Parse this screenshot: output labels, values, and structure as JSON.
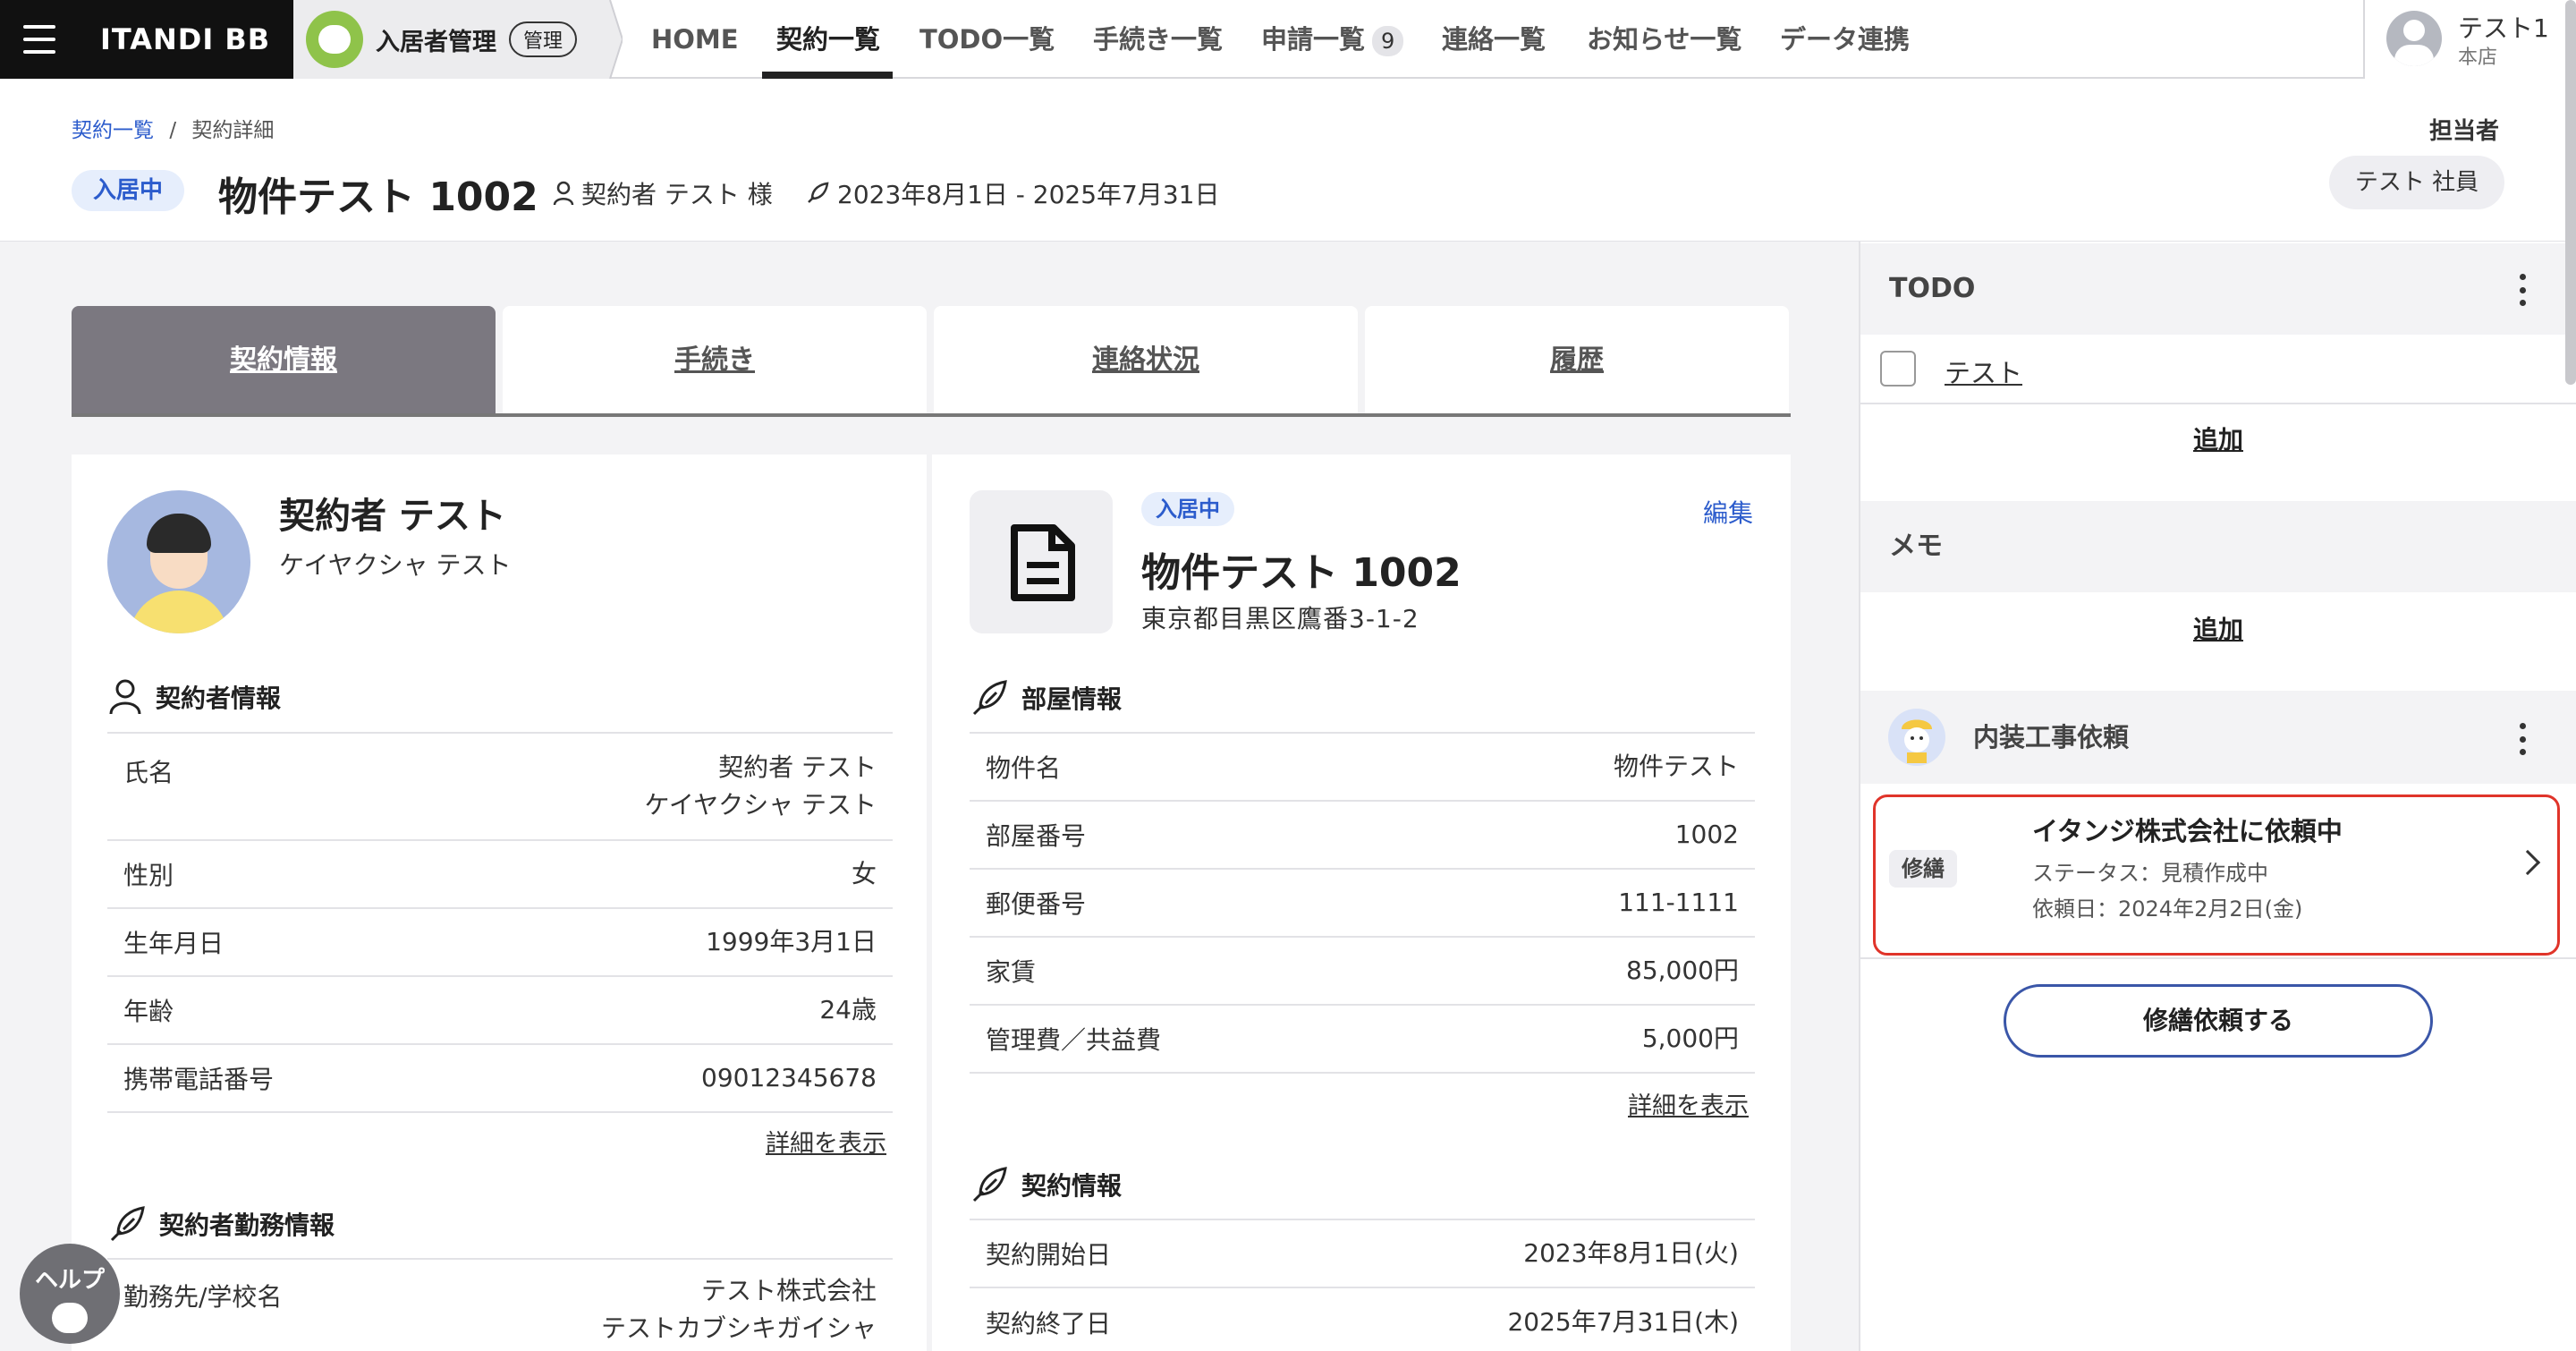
{
  "brand": "ITANDI BB",
  "product": {
    "name": "入居者管理",
    "badge": "管理"
  },
  "nav": [
    {
      "label": "HOME"
    },
    {
      "label": "契約一覧"
    },
    {
      "label": "TODO一覧"
    },
    {
      "label": "手続き一覧"
    },
    {
      "label": "申請一覧",
      "count": "9"
    },
    {
      "label": "連絡一覧"
    },
    {
      "label": "お知らせ一覧"
    },
    {
      "label": "データ連携"
    }
  ],
  "user": {
    "name": "テスト1",
    "branch": "本店"
  },
  "breadcrumb": {
    "parent": "契約一覧",
    "separator": "/",
    "current": "契約詳細"
  },
  "header": {
    "status": "入居中",
    "property_title": "物件テスト 1002",
    "contractor": "契約者 テスト 様",
    "period": "2023年8月1日 - 2025年7月31日",
    "assignee_label": "担当者",
    "assignee": "テスト 社員"
  },
  "tabs": [
    {
      "label": "契約情報"
    },
    {
      "label": "手続き"
    },
    {
      "label": "連絡状況"
    },
    {
      "label": "履歴"
    }
  ],
  "person": {
    "name": "契約者 テスト",
    "kana": "ケイヤクシャ テスト",
    "info_title": "契約者情報",
    "rows": [
      {
        "label": "氏名",
        "value": "契約者 テスト",
        "value2": "ケイヤクシャ テスト"
      },
      {
        "label": "性別",
        "value": "女"
      },
      {
        "label": "生年月日",
        "value": "1999年3月1日"
      },
      {
        "label": "年齢",
        "value": "24歳"
      },
      {
        "label": "携帯電話番号",
        "value": "09012345678"
      }
    ],
    "detail_link": "詳細を表示",
    "work_title": "契約者勤務情報",
    "work_rows": [
      {
        "label": "勤務先/学校名",
        "value": "テスト株式会社",
        "value2": "テストカブシキガイシャ"
      }
    ]
  },
  "property": {
    "status": "入居中",
    "edit": "編集",
    "name": "物件テスト 1002",
    "address": "東京都目黒区鷹番3-1-2",
    "room_title": "部屋情報",
    "rows": [
      {
        "label": "物件名",
        "value": "物件テスト"
      },
      {
        "label": "部屋番号",
        "value": "1002"
      },
      {
        "label": "郵便番号",
        "value": "111-1111"
      },
      {
        "label": "家賃",
        "value": "85,000円"
      },
      {
        "label": "管理費／共益費",
        "value": "5,000円"
      }
    ],
    "detail_link": "詳細を表示",
    "contract_title": "契約情報",
    "contract_rows": [
      {
        "label": "契約開始日",
        "value": "2023年8月1日(火)"
      },
      {
        "label": "契約終了日",
        "value": "2025年7月31日(木)"
      }
    ]
  },
  "side": {
    "todo_title": "TODO",
    "todo_item": "テスト",
    "todo_add": "追加",
    "memo_title": "メモ",
    "memo_add": "追加",
    "repair_title": "内装工事依頼",
    "request": {
      "tag": "修繕",
      "title": "イタンジ株式会社に依頼中",
      "status": "ステータス：見積作成中",
      "date": "依頼日：2024年2月2日(金)"
    },
    "repair_button": "修繕依頼する"
  },
  "help": "ヘルプ",
  "colors": {
    "accent": "#2c5ccc",
    "highlight_border": "#e0342a",
    "active_tab": "#7b7880"
  }
}
